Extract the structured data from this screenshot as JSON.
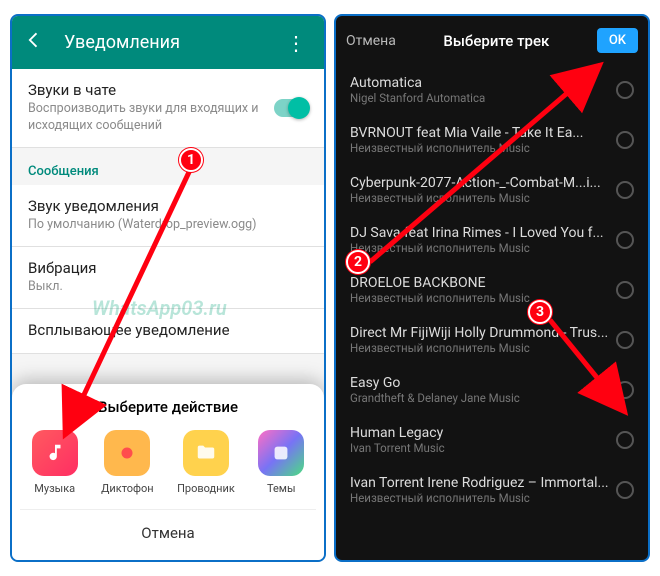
{
  "left": {
    "header_title": "Уведомления",
    "row_sounds": {
      "title": "Звуки в чате",
      "sub": "Воспроизводить звуки для входящих и исходящих сообщений"
    },
    "section_msg": "Сообщения",
    "row_sound": {
      "title": "Звук уведомления",
      "sub": "По умолчанию (Waterdrop_preview.ogg)"
    },
    "row_vibr": {
      "title": "Вибрация",
      "sub": "Выкл."
    },
    "row_popup": {
      "title": "Всплывающее уведомление"
    },
    "sheet_title": "Выберите действие",
    "apps": {
      "music": "Музыка",
      "rec": "Диктофон",
      "file": "Проводник",
      "theme": "Темы"
    },
    "cancel": "Отмена",
    "watermark": "WhatsApp03.ru"
  },
  "right": {
    "cancel": "Отмена",
    "title": "Выберите трек",
    "ok": "OK",
    "tracks": [
      {
        "title": "Automatica",
        "sub": "Nigel Stanford Automatica"
      },
      {
        "title": "BVRNOUT feat Mia Vaile - Take It Ea...",
        "sub": "Неизвестный исполнитель Music"
      },
      {
        "title": "Cyberpunk-2077-Action-_-Combat-M...i...",
        "sub": "Неизвестный исполнитель Music"
      },
      {
        "title": "DJ Sava feat Irina Rimes - I Loved You f...",
        "sub": "Неизвестный исполнитель Music"
      },
      {
        "title": "DROELOE BACKBONE",
        "sub": "Неизвестный исполнитель Music"
      },
      {
        "title": "Direct Mr FijiWiji Holly Drummond - Trus...",
        "sub": "Неизвестный исполнитель Music"
      },
      {
        "title": "Easy Go",
        "sub": "Grandtheft & Delaney Jane Music"
      },
      {
        "title": "Human Legacy",
        "sub": "Ivan Torrent Music"
      },
      {
        "title": "Ivan Torrent  Irene Rodriguez – Immortal...",
        "sub": "Неизвестный исполнитель Music"
      }
    ]
  },
  "anno": {
    "n1": "1",
    "n2": "2",
    "n3": "3"
  }
}
